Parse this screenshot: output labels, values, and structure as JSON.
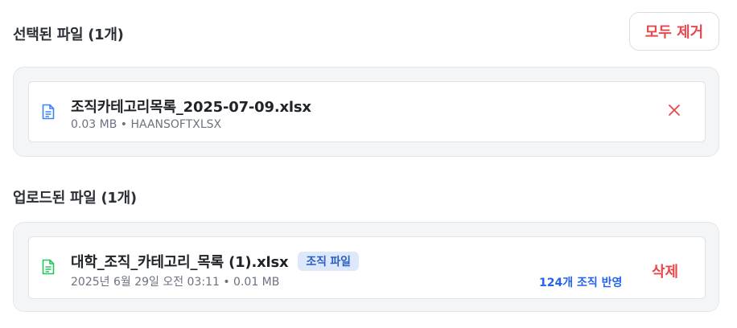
{
  "selected": {
    "title": "선택된 파일 (1개)",
    "remove_all_label": "모두 제거",
    "files": [
      {
        "name": "조직카테고리목록_2025-07-09.xlsx",
        "meta": "0.03 MB • HAANSOFTXLSX",
        "icon": "file-text-icon",
        "icon_color": "#3b82f6"
      }
    ]
  },
  "uploaded": {
    "title": "업로드된 파일 (1개)",
    "files": [
      {
        "name": "대학_조직_카테고리_목록 (1).xlsx",
        "tag": "조직 파일",
        "meta": "2025년 6월 29일 오전 03:11 • 0.01 MB",
        "applied": "124개 조직 반영",
        "delete_label": "삭제",
        "icon": "file-text-icon",
        "icon_color": "#22c55e"
      }
    ]
  },
  "colors": {
    "danger": "#e5484d",
    "accent_blue": "#2563eb",
    "tag_bg": "#dde9fb"
  }
}
